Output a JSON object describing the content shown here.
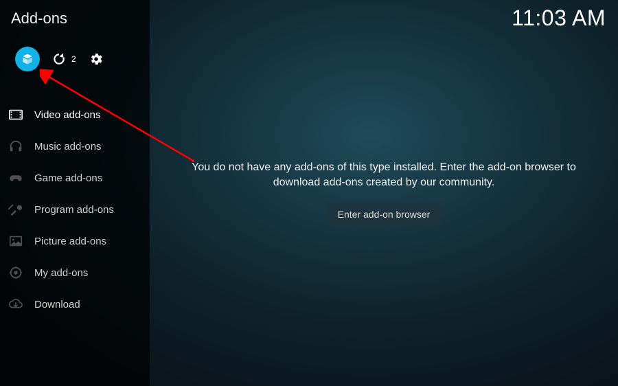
{
  "header": {
    "title": "Add-ons",
    "clock": "11:03 AM"
  },
  "toolbar": {
    "refresh_count": "2"
  },
  "sidebar": {
    "items": [
      {
        "label": "Video add-ons"
      },
      {
        "label": "Music add-ons"
      },
      {
        "label": "Game add-ons"
      },
      {
        "label": "Program add-ons"
      },
      {
        "label": "Picture add-ons"
      },
      {
        "label": "My add-ons"
      },
      {
        "label": "Download"
      }
    ]
  },
  "main": {
    "empty_message": "You do not have any add-ons of this type installed. Enter the add-on browser to download add-ons created by our community.",
    "enter_button": "Enter add-on browser"
  }
}
